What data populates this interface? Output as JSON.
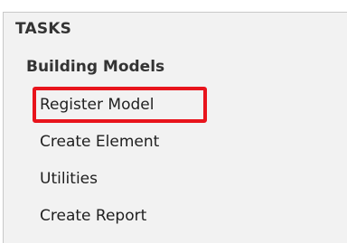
{
  "panel": {
    "title": "TASKS",
    "section": {
      "heading": "Building Models",
      "items": [
        {
          "label": "Register Model",
          "highlighted": true
        },
        {
          "label": "Create Element",
          "highlighted": false
        },
        {
          "label": "Utilities",
          "highlighted": false
        },
        {
          "label": "Create Report",
          "highlighted": false
        }
      ]
    }
  },
  "colors": {
    "panel_background": "#f2f2f2",
    "highlight_border": "#e8141c",
    "text": "#1f1f1f"
  }
}
